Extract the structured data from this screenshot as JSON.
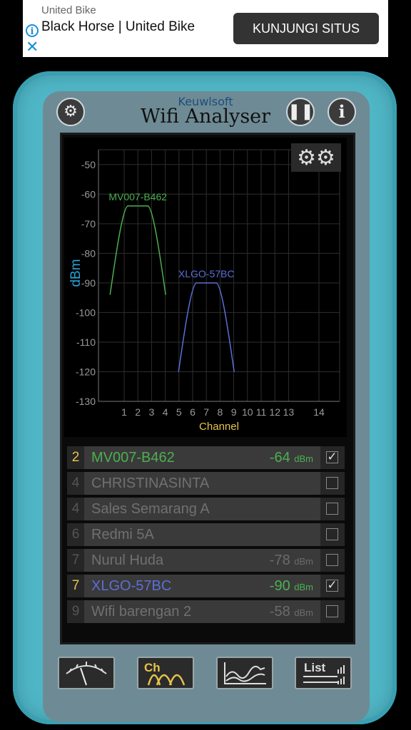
{
  "ad": {
    "sponsor": "United Bike",
    "headline": "Black Horse | United Bike",
    "cta": "KUNJUNGI SITUS"
  },
  "app": {
    "brand_small": "Keuwlsoft",
    "brand_big": "Wifi Analyser"
  },
  "icons": {
    "settings": "gear-icon",
    "pause": "pause-icon",
    "info": "info-icon",
    "chart_settings": "gears-icon",
    "meter": "meter-icon",
    "channel": "channel-graph-icon",
    "time": "time-graph-icon",
    "list": "list-icon"
  },
  "chart_data": {
    "type": "line",
    "xlabel": "Channel",
    "ylabel": "dBm",
    "x_ticks": [
      "1",
      "2",
      "3",
      "4",
      "5",
      "6",
      "7",
      "8",
      "9",
      "10",
      "11",
      "12",
      "13",
      "14"
    ],
    "y_ticks": [
      "-50",
      "-60",
      "-70",
      "-80",
      "-90",
      "-100",
      "-110",
      "-120",
      "-130"
    ],
    "ylim": [
      -130,
      -45
    ],
    "grid": true,
    "series": [
      {
        "name": "MV007-B462",
        "channel": 2,
        "peak_dbm": -64,
        "floor_dbm": -94,
        "color": "#4caf50"
      },
      {
        "name": "XLGO-57BC",
        "channel": 7,
        "peak_dbm": -90,
        "floor_dbm": -120,
        "color": "#5b6fd6"
      }
    ]
  },
  "networks": [
    {
      "channel": "2",
      "ssid": "MV007-B462",
      "signal": "-64",
      "unit": "dBm",
      "checked": true,
      "color": "#4caf50",
      "num_active": true
    },
    {
      "channel": "4",
      "ssid": "CHRISTINASINTA",
      "signal": "",
      "unit": "",
      "checked": false,
      "color": "#707070",
      "num_active": false
    },
    {
      "channel": "4",
      "ssid": "Sales Semarang A",
      "signal": "",
      "unit": "",
      "checked": false,
      "color": "#707070",
      "num_active": false
    },
    {
      "channel": "6",
      "ssid": "Redmi 5A",
      "signal": "",
      "unit": "",
      "checked": false,
      "color": "#707070",
      "num_active": false
    },
    {
      "channel": "7",
      "ssid": "Nurul Huda",
      "signal": "-78",
      "unit": "dBm",
      "checked": false,
      "color": "#707070",
      "num_active": false
    },
    {
      "channel": "7",
      "ssid": "XLGO-57BC",
      "signal": "-90",
      "unit": "dBm",
      "checked": true,
      "color": "#5b6fd6",
      "num_active": true
    },
    {
      "channel": "9",
      "ssid": "Wifi barengan 2",
      "signal": "-58",
      "unit": "dBm",
      "checked": false,
      "color": "#707070",
      "num_active": false
    }
  ],
  "bottom_buttons": {
    "channel_label": "Ch",
    "list_label": "List"
  },
  "colors": {
    "device": "#4fb6c6",
    "accent_yellow": "#e6c34a",
    "green_signal": "#4caf50",
    "blue_signal": "#5b6fd6"
  }
}
